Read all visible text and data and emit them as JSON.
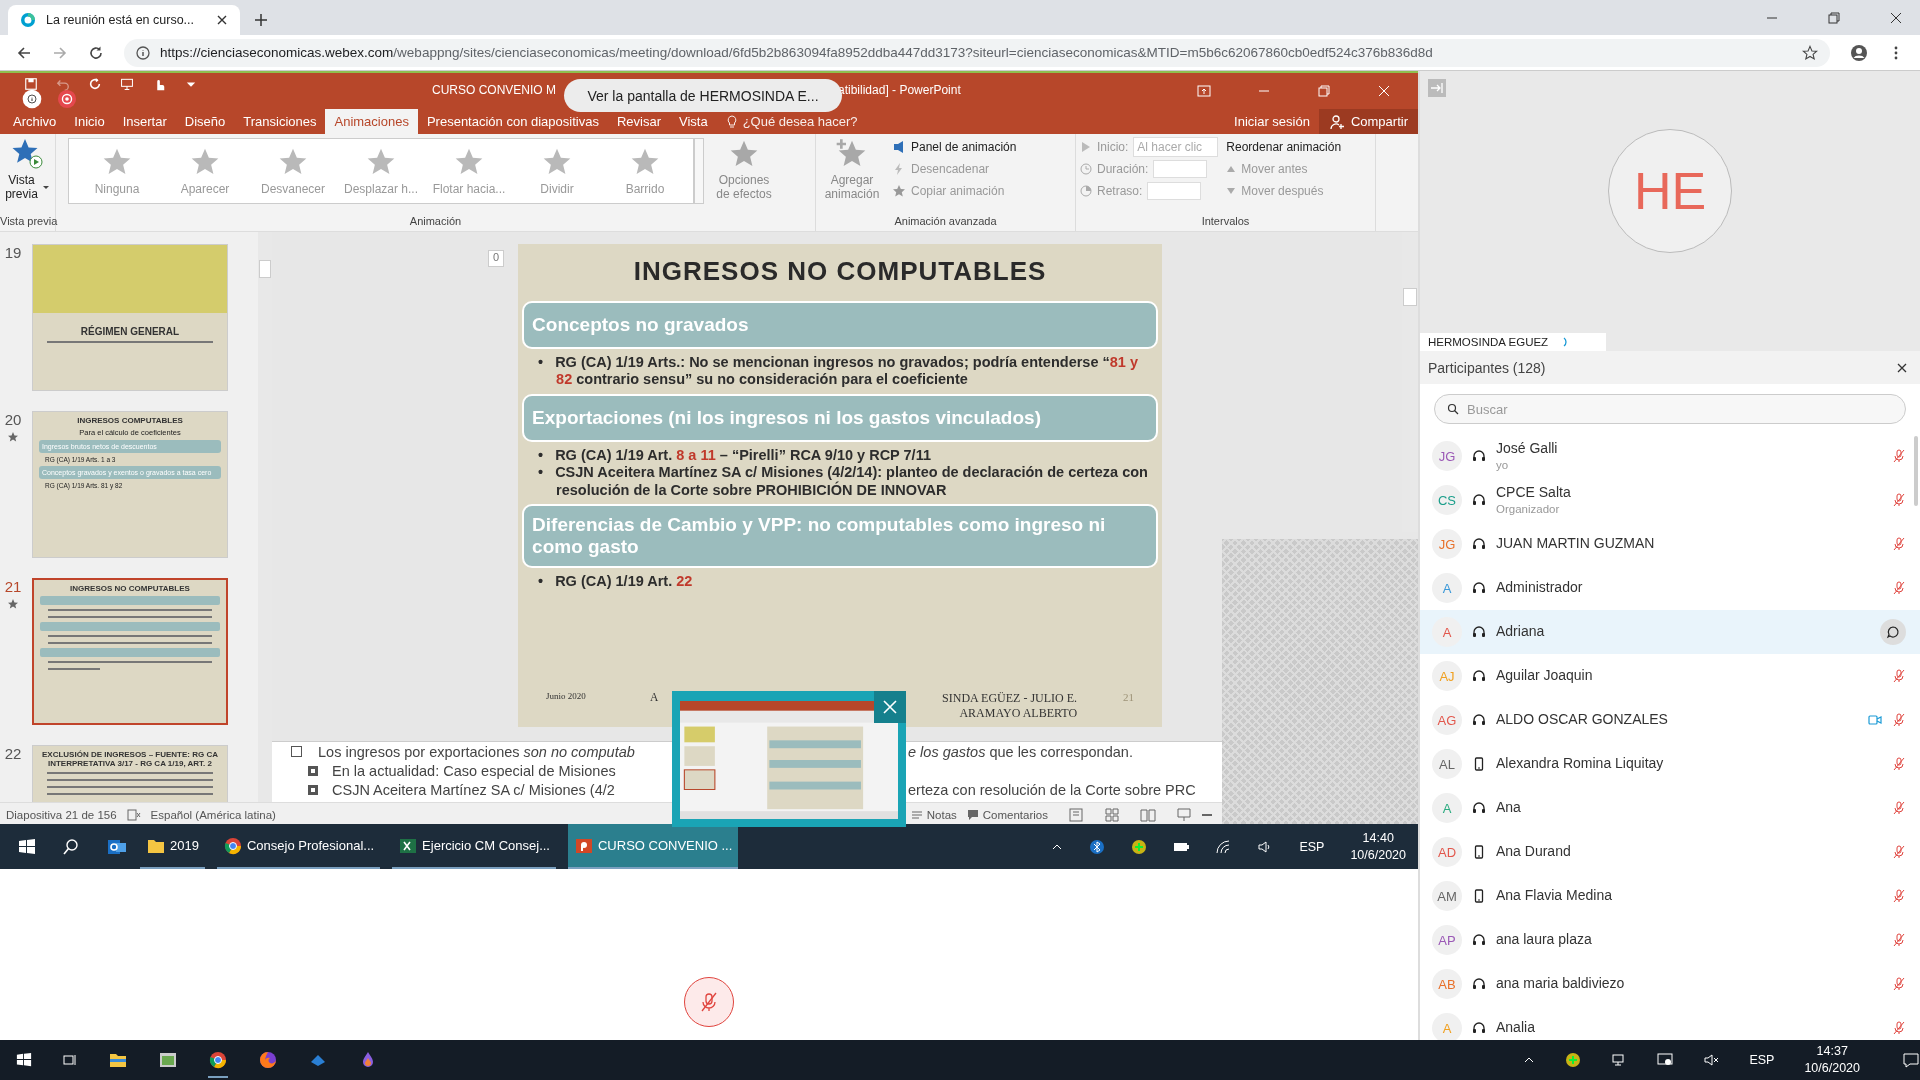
{
  "browser": {
    "tab_title": "La reunión está en curso...",
    "url_host": "https://cienciaseconomicas.webex.com",
    "url_path": "/webappng/sites/cienciaseconomicas/meeting/download/6fd5b2b863094fa8952ddba447dd3173?siteurl=cienciaseconomicas&MTID=m5b6c62067860cb0edf524c376b836d8d"
  },
  "shared_screen": {
    "toast": "Ver la pantalla de  HERMOSINDA E...",
    "powerpoint": {
      "title_start": "CURSO CONVENIO M",
      "title_end": "atibilidad] - PowerPoint",
      "menu_tabs": [
        {
          "label": "Archivo",
          "selected": false
        },
        {
          "label": "Inicio",
          "selected": false
        },
        {
          "label": "Insertar",
          "selected": false
        },
        {
          "label": "Diseño",
          "selected": false
        },
        {
          "label": "Transiciones",
          "selected": false
        },
        {
          "label": "Animaciones",
          "selected": true
        },
        {
          "label": "Presentación con diapositivas",
          "selected": false
        },
        {
          "label": "Revisar",
          "selected": false
        },
        {
          "label": "Vista",
          "selected": false
        }
      ],
      "tell_me": "¿Qué desea hacer?",
      "sign_in": "Iniciar sesión",
      "share": "Compartir",
      "ribbon": {
        "preview": "Vista previa",
        "preview_group": "Vista previa",
        "effects": [
          "Ninguna",
          "Aparecer",
          "Desvanecer",
          "Desplazar h...",
          "Flotar hacia...",
          "Dividir",
          "Barrido"
        ],
        "effect_options": "Opciones de efectos",
        "animation_group": "Animación",
        "add_animation": "Agregar animación",
        "advanced": [
          "Panel de animación",
          "Desencadenar",
          "Copiar animación"
        ],
        "advanced_group": "Animación avanzada",
        "start_label": "Inicio:",
        "start_value": "Al hacer clic",
        "duration_label": "Duración:",
        "delay_label": "Retraso:",
        "reorder": "Reordenar animación",
        "move_earlier": "Mover antes",
        "move_later": "Mover después",
        "timing_group": "Intervalos"
      },
      "thumbnails": [
        {
          "number": "19",
          "starred": false,
          "selected": false,
          "kind": "title",
          "title": "RÉGIMEN GENERAL"
        },
        {
          "number": "20",
          "starred": true,
          "selected": false,
          "kind": "content",
          "title": "INGRESOS COMPUTABLES",
          "subtitle": "Para el cálculo de coeficientes",
          "boxes": [
            {
              "heading": "Ingresos brutos netos de descuentos",
              "bullet": "RG (CA) 1/19 Arts. 1 a 3"
            },
            {
              "heading": "Conceptos gravados y exentos o gravados a tasa cero",
              "bullet": "RG (CA) 1/19 Arts. 81 y 82"
            }
          ]
        },
        {
          "number": "21",
          "starred": true,
          "selected": true,
          "kind": "content",
          "title": "INGRESOS NO COMPUTABLES"
        },
        {
          "number": "22",
          "starred": false,
          "selected": false,
          "kind": "list",
          "title": "EXCLUSIÓN DE INGRESOS – FUENTE: RG CA INTERPRETATIVA 3/17 - RG CA 1/19, ART. 2"
        }
      ],
      "slide_marker": "0",
      "slide": {
        "title": "INGRESOS NO COMPUTABLES",
        "sections": [
          {
            "heading": "Conceptos no gravados",
            "bullets": [
              {
                "marker": "•",
                "segments": [
                  {
                    "text": "RG (CA) 1/19 Arts.: No se mencionan ingresos no gravados; podría entenderse “",
                    "highlight": false
                  },
                  {
                    "text": "81 y 82",
                    "highlight": true
                  },
                  {
                    "text": " contrario sensu” su no consideración para el coeficiente",
                    "highlight": false
                  }
                ]
              }
            ]
          },
          {
            "heading": "Exportaciones (ni los ingresos ni los gastos vinculados)",
            "bullets": [
              {
                "marker": "•",
                "segments": [
                  {
                    "text": "RG (CA) 1/19 Art. ",
                    "highlight": false
                  },
                  {
                    "text": "8 a 11",
                    "highlight": true
                  },
                  {
                    "text": " – “Pirelli” RCA 9/10 y RCP 7/11",
                    "highlight": false
                  }
                ]
              },
              {
                "marker": "•",
                "segments": [
                  {
                    "text": "CSJN Aceitera Martínez SA c/ Misiones (4/2/14): planteo de declaración de certeza con resolución de la Corte sobre PROHIBICIÓN DE INNOVAR",
                    "highlight": false
                  }
                ]
              }
            ]
          },
          {
            "heading": "Diferencias de Cambio y VPP: no computables como ingreso ni como gasto",
            "bullets": [
              {
                "marker": "•",
                "segments": [
                  {
                    "text": "RG (CA) 1/19 Art. ",
                    "highlight": false
                  },
                  {
                    "text": "22",
                    "highlight": true
                  }
                ]
              }
            ]
          }
        ],
        "date": "Junio 2020",
        "author_start": "A",
        "author_lines": [
          "SINDA EGÜEZ - JULIO E.",
          "ARAMAYO ALBERTO"
        ],
        "page": "21"
      },
      "notes": [
        {
          "left": "Los ingresos por exportaciones *son no computab*",
          "right": "*e los gastos* que les correspondan.",
          "children": [
            {
              "left": "En la actualidad: Caso especial de Misiones"
            },
            {
              "left": "CSJN Aceitera Martínez SA c/ Misiones (4/2",
              "right": "erteza con resolución de la Corte sobre PRC"
            }
          ]
        }
      ],
      "status": {
        "slide_count": "Diapositiva 21 de 156",
        "language": "Español (América latina)",
        "notes": "Notas",
        "comments": "Comentarios"
      }
    },
    "taskbar": {
      "items": [
        {
          "kind": "folder",
          "label": "2019",
          "selected": false
        },
        {
          "kind": "chrome",
          "label": "Consejo Profesional...",
          "selected": false
        },
        {
          "kind": "excel",
          "label": "Ejercicio CM Consej...",
          "selected": false
        },
        {
          "kind": "powerpoint",
          "label": "CURSO CONVENIO ...",
          "selected": true
        }
      ],
      "language": "ESP",
      "time": "14:40",
      "date": "10/6/2020"
    }
  },
  "webex_panel": {
    "presenter_initials": "HE",
    "presenter_name": "HERMOSINDA EGUEZ",
    "participants_title": "Participantes (128)",
    "search_placeholder": "Buscar",
    "participants": [
      {
        "initials": "JG",
        "color": "#9b59b6",
        "name": "José Galli",
        "role": "yo",
        "kind": "headset",
        "muted": true,
        "video": false,
        "selected": false
      },
      {
        "initials": "CS",
        "color": "#1a9e8a",
        "name": "CPCE Salta",
        "role": "Organizador",
        "kind": "headset",
        "muted": true,
        "video": false,
        "selected": false
      },
      {
        "initials": "JG",
        "color": "#e8702a",
        "name": "JUAN MARTIN GUZMAN",
        "kind": "headset",
        "muted": true,
        "video": false,
        "selected": false
      },
      {
        "initials": "A",
        "color": "#3a98d8",
        "name": "Administrador",
        "kind": "headset",
        "muted": true,
        "video": false,
        "selected": false
      },
      {
        "initials": "A",
        "color": "#e2574c",
        "name": "Adriana",
        "kind": "headset",
        "muted": false,
        "video": false,
        "selected": true
      },
      {
        "initials": "AJ",
        "color": "#f0a020",
        "name": "Aguilar Joaquin",
        "kind": "headset",
        "muted": true,
        "video": false,
        "selected": false
      },
      {
        "initials": "AG",
        "color": "#e2574c",
        "name": "ALDO OSCAR GONZALES",
        "kind": "headset",
        "muted": true,
        "video": true,
        "selected": false
      },
      {
        "initials": "AL",
        "color": "#666666",
        "name": "Alexandra Romina Liquitay",
        "kind": "phone",
        "muted": true,
        "video": false,
        "selected": false
      },
      {
        "initials": "A",
        "color": "#2bab80",
        "name": "Ana",
        "kind": "headset",
        "muted": true,
        "video": false,
        "selected": false
      },
      {
        "initials": "AD",
        "color": "#e2574c",
        "name": "Ana Durand",
        "kind": "phone",
        "muted": true,
        "video": false,
        "selected": false
      },
      {
        "initials": "AM",
        "color": "#666666",
        "name": "Ana Flavia Medina",
        "kind": "phone",
        "muted": true,
        "video": false,
        "selected": false
      },
      {
        "initials": "AP",
        "color": "#9b59b6",
        "name": "ana laura plaza",
        "kind": "headset",
        "muted": true,
        "video": false,
        "selected": false
      },
      {
        "initials": "AB",
        "color": "#e8702a",
        "name": "ana maria baldiviezo",
        "kind": "headset",
        "muted": true,
        "video": false,
        "selected": false
      },
      {
        "initials": "A",
        "color": "#f0a020",
        "name": "Analia",
        "kind": "headset",
        "muted": true,
        "video": false,
        "selected": false
      }
    ]
  },
  "mic_muted": true,
  "system_tray": {
    "language": "ESP",
    "time": "14:37",
    "date": "10/6/2020"
  }
}
